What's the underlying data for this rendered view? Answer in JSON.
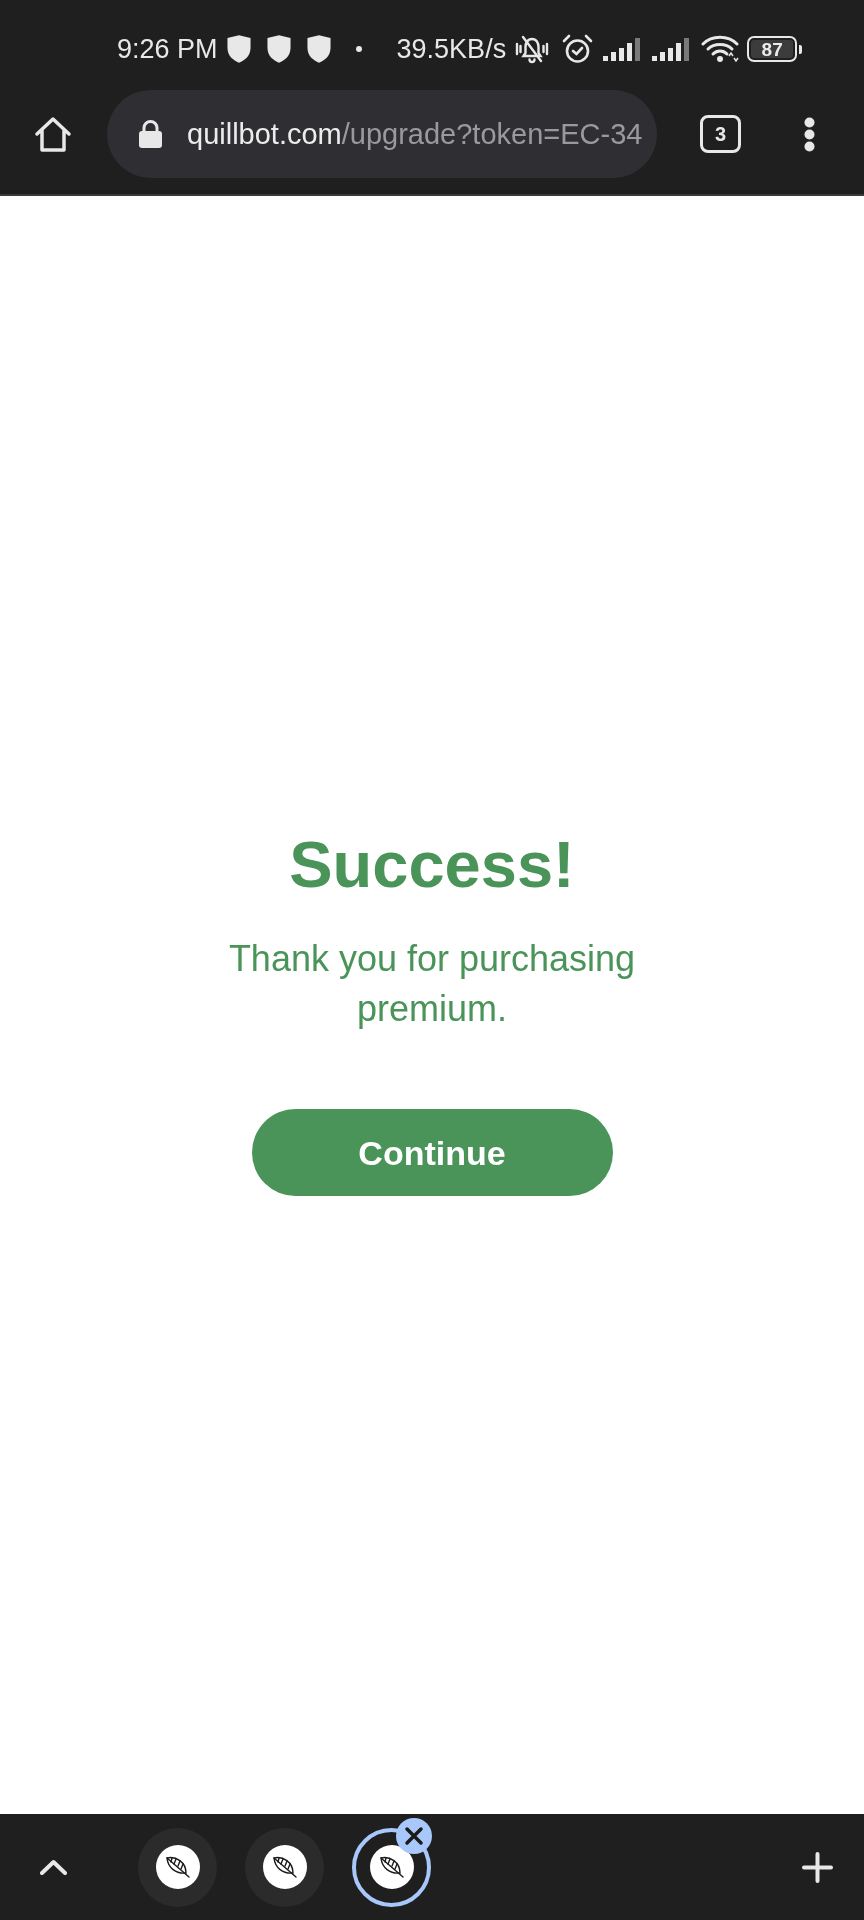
{
  "status_bar": {
    "time": "9:26 PM",
    "network_speed": "39.5KB/s",
    "battery": "87"
  },
  "toolbar": {
    "url": {
      "host": "quillbot.com",
      "path": "/upgrade?token=EC-34"
    },
    "tab_count": "3"
  },
  "page": {
    "title": "Success!",
    "message": "Thank you for purchasing premium.",
    "button": "Continue"
  },
  "tab_strip": {
    "tabs": [
      {
        "selected": false
      },
      {
        "selected": false
      },
      {
        "selected": true
      }
    ]
  }
}
